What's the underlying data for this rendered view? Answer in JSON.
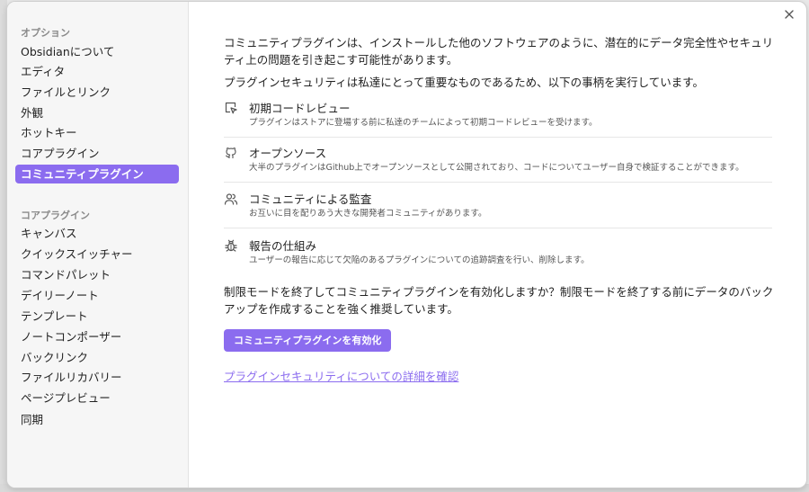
{
  "colors": {
    "accent": "#8b6cef",
    "text": "#222222",
    "muted": "#8a8a8a"
  },
  "sidebar": {
    "options_title": "オプション",
    "options_items": [
      {
        "label": "Obsidianについて"
      },
      {
        "label": "エディタ"
      },
      {
        "label": "ファイルとリンク"
      },
      {
        "label": "外観"
      },
      {
        "label": "ホットキー"
      },
      {
        "label": "コアプラグイン"
      },
      {
        "label": "コミュニティプラグイン",
        "active": true
      }
    ],
    "core_title": "コアプラグイン",
    "core_items": [
      {
        "label": "キャンバス"
      },
      {
        "label": "クイックスイッチャー"
      },
      {
        "label": "コマンドパレット"
      },
      {
        "label": "デイリーノート"
      },
      {
        "label": "テンプレート"
      },
      {
        "label": "ノートコンポーザー"
      },
      {
        "label": "バックリンク"
      },
      {
        "label": "ファイルリカバリー"
      },
      {
        "label": "ページプレビュー"
      },
      {
        "label": "同期"
      }
    ]
  },
  "close_icon": "close-icon",
  "main": {
    "intro": "コミュニティプラグインは、インストールした他のソフトウェアのように、潜在的にデータ完全性やセキュリティ上の問題を引き起こす可能性があります。",
    "security_statement": "プラグインセキュリティは私達にとって重要なものであるため、以下の事柄を実行しています。",
    "features": [
      {
        "icon": "pointer-icon",
        "title": "初期コードレビュー",
        "desc": "プラグインはストアに登場する前に私達のチームによって初期コードレビューを受けます。"
      },
      {
        "icon": "github-icon",
        "title": "オープンソース",
        "desc": "大半のプラグインはGithub上でオープンソースとして公開されており、コードについてユーザー自身で検証することができます。"
      },
      {
        "icon": "users-icon",
        "title": "コミュニティによる監査",
        "desc": "お互いに目を配りあう大きな開発者コミュニティがあります。"
      },
      {
        "icon": "bug-icon",
        "title": "報告の仕組み",
        "desc": "ユーザーの報告に応じて欠陥のあるプラグインについての追跡調査を行い、削除します。"
      }
    ],
    "restricted_mode_text": "制限モードを終了してコミュニティプラグインを有効化しますか？制限モードを終了する前にデータのバックアップを作成することを強く推奨しています。",
    "enable_button": "コミュニティプラグインを有効化",
    "learn_more_link": "プラグインセキュリティについての詳細を確認"
  }
}
